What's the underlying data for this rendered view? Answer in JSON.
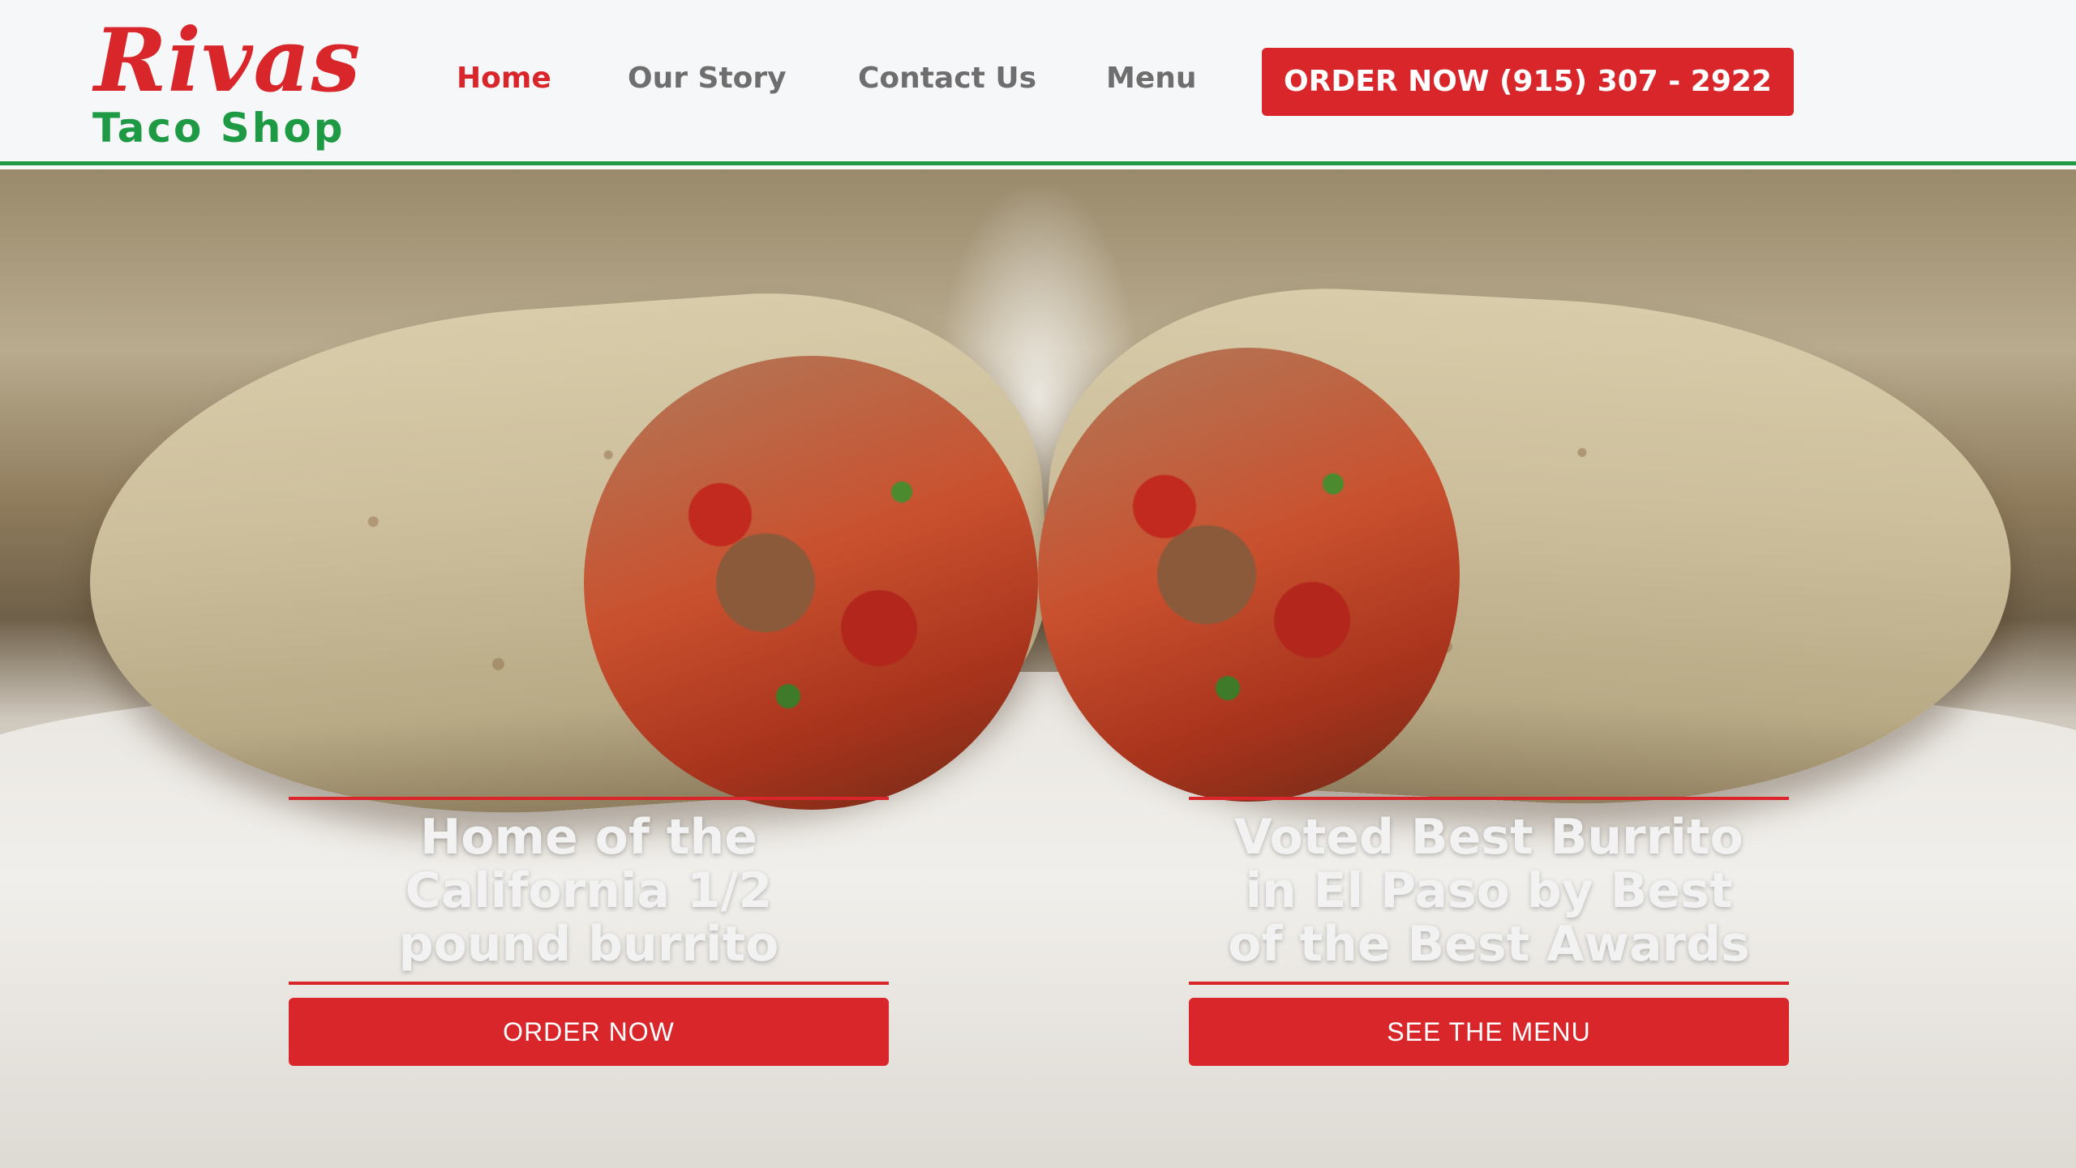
{
  "colors": {
    "brand_red": "#d9262a",
    "brand_green": "#1f9a44",
    "nav_gray": "#6e6e6e",
    "header_bg": "#f6f7f9"
  },
  "logo": {
    "script": "Rivas",
    "subtitle": "Taco Shop"
  },
  "nav": {
    "items": [
      {
        "label": "Home",
        "active": true
      },
      {
        "label": "Our Story",
        "active": false
      },
      {
        "label": "Contact Us",
        "active": false
      },
      {
        "label": "Menu",
        "active": false
      }
    ],
    "order_button": "ORDER NOW (915) 307 - 2922"
  },
  "hero": {
    "image": "burrito-cross-section-photo",
    "promos": [
      {
        "title": "Home of the California 1/2 pound burrito",
        "button": "ORDER NOW"
      },
      {
        "title": "Voted Best Burrito in El Paso by Best of the Best Awards",
        "button": "SEE THE MENU"
      }
    ]
  }
}
